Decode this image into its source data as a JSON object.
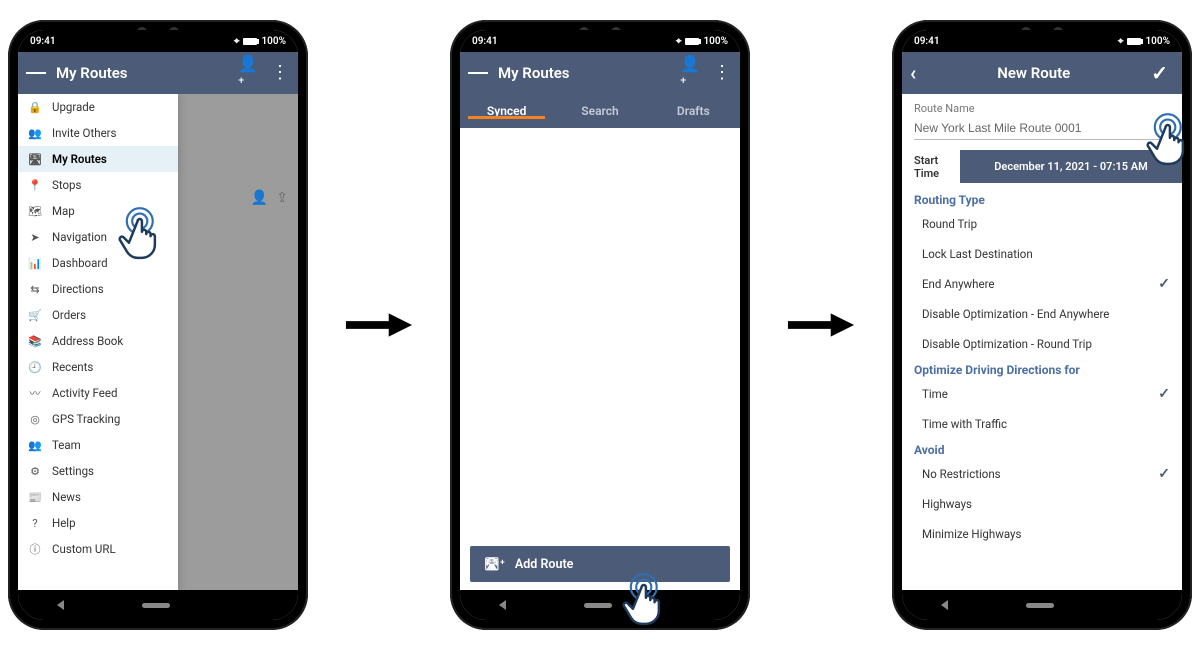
{
  "status": {
    "time": "09:41",
    "battery": "100%"
  },
  "phone1": {
    "title": "My Routes",
    "drawer_items": [
      {
        "icon": "🔒",
        "label": "Upgrade"
      },
      {
        "icon": "👥",
        "label": "Invite Others"
      },
      {
        "icon": "🛣",
        "label": "My Routes",
        "selected": true
      },
      {
        "icon": "📍",
        "label": "Stops"
      },
      {
        "icon": "🗺",
        "label": "Map"
      },
      {
        "icon": "➤",
        "label": "Navigation"
      },
      {
        "icon": "📊",
        "label": "Dashboard"
      },
      {
        "icon": "⇆",
        "label": "Directions"
      },
      {
        "icon": "🛒",
        "label": "Orders"
      },
      {
        "icon": "📚",
        "label": "Address Book"
      },
      {
        "icon": "🕘",
        "label": "Recents"
      },
      {
        "icon": "〰",
        "label": "Activity Feed"
      },
      {
        "icon": "◎",
        "label": "GPS Tracking"
      },
      {
        "icon": "👥",
        "label": "Team"
      },
      {
        "icon": "⚙",
        "label": "Settings"
      },
      {
        "icon": "📰",
        "label": "News"
      },
      {
        "icon": "?",
        "label": "Help"
      },
      {
        "icon": "ⓘ",
        "label": "Custom URL"
      }
    ]
  },
  "phone2": {
    "title": "My Routes",
    "tabs": [
      "Synced",
      "Search",
      "Drafts"
    ],
    "active_tab": 0,
    "add_route_label": "Add Route"
  },
  "phone3": {
    "title": "New Route",
    "route_name_label": "Route Name",
    "route_name_value": "New York Last Mile Route 0001",
    "start_time_label": "Start Time",
    "start_time_value": "December 11, 2021 - 07:15 AM",
    "routing_type_header": "Routing Type",
    "routing_type_options": [
      {
        "label": "Round Trip",
        "checked": false
      },
      {
        "label": "Lock Last Destination",
        "checked": false
      },
      {
        "label": "End Anywhere",
        "checked": true
      },
      {
        "label": "Disable Optimization - End Anywhere",
        "checked": false
      },
      {
        "label": "Disable Optimization - Round Trip",
        "checked": false
      }
    ],
    "optimize_header": "Optimize Driving Directions for",
    "optimize_options": [
      {
        "label": "Time",
        "checked": true
      },
      {
        "label": "Time with Traffic",
        "checked": false
      }
    ],
    "avoid_header": "Avoid",
    "avoid_options": [
      {
        "label": "No Restrictions",
        "checked": true
      },
      {
        "label": "Highways",
        "checked": false
      },
      {
        "label": "Minimize Highways",
        "checked": false
      }
    ]
  }
}
